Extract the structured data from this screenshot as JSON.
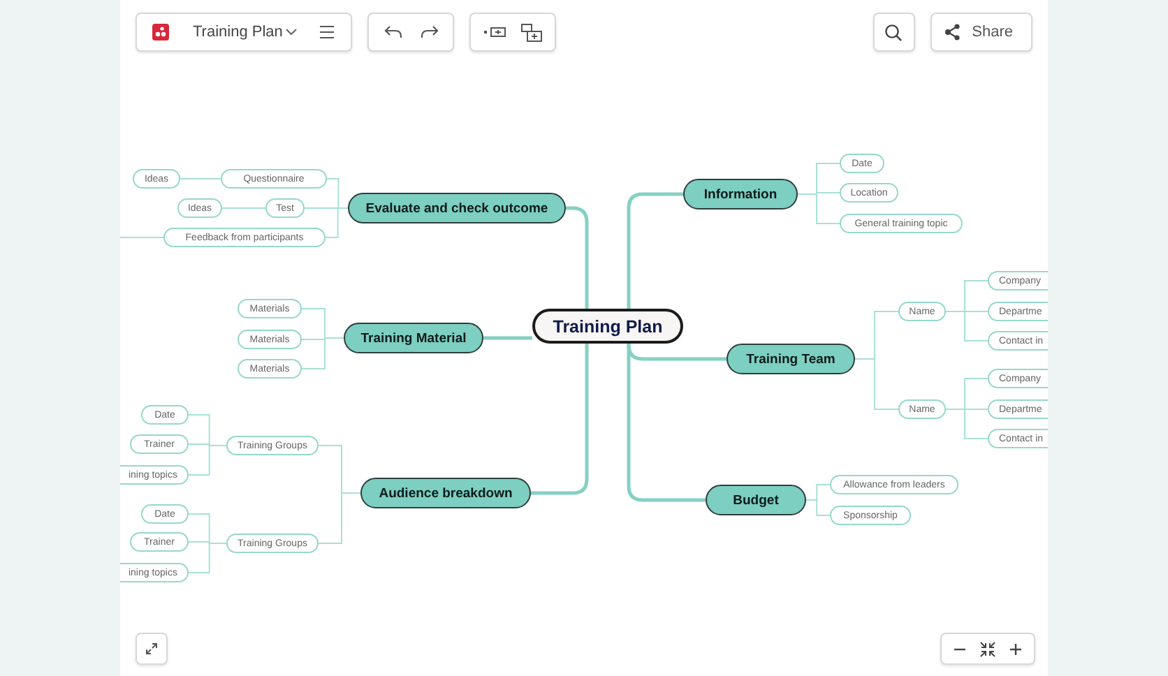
{
  "toolbar": {
    "title": "Training Plan",
    "share": "Share"
  },
  "mindmap": {
    "central": "Training Plan",
    "branches": [
      {
        "label": "Evaluate and check outcome",
        "children": [
          {
            "label": "Questionnaire",
            "children": [
              {
                "label": "Ideas"
              }
            ]
          },
          {
            "label": "Test",
            "children": [
              {
                "label": "Ideas"
              }
            ]
          },
          {
            "label": "Feedback from participants"
          }
        ]
      },
      {
        "label": "Training Material",
        "children": [
          {
            "label": "Materials"
          },
          {
            "label": "Materials"
          },
          {
            "label": "Materials"
          }
        ]
      },
      {
        "label": "Audience breakdown",
        "children": [
          {
            "label": "Training Groups",
            "children": [
              {
                "label": "Date"
              },
              {
                "label": "Trainer"
              },
              {
                "label": "ining topics"
              }
            ]
          },
          {
            "label": "Training Groups",
            "children": [
              {
                "label": "Date"
              },
              {
                "label": "Trainer"
              },
              {
                "label": "ining topics"
              }
            ]
          }
        ]
      },
      {
        "label": "Information",
        "children": [
          {
            "label": "Date"
          },
          {
            "label": "Location"
          },
          {
            "label": "General training topic"
          }
        ]
      },
      {
        "label": "Training Team",
        "children": [
          {
            "label": "Name",
            "children": [
              {
                "label": "Company"
              },
              {
                "label": "Departme"
              },
              {
                "label": "Contact in"
              }
            ]
          },
          {
            "label": "Name",
            "children": [
              {
                "label": "Company"
              },
              {
                "label": "Departme"
              },
              {
                "label": "Contact in"
              }
            ]
          }
        ]
      },
      {
        "label": "Budget",
        "children": [
          {
            "label": "Allowance from leaders"
          },
          {
            "label": "Sponsorship"
          }
        ]
      }
    ]
  }
}
